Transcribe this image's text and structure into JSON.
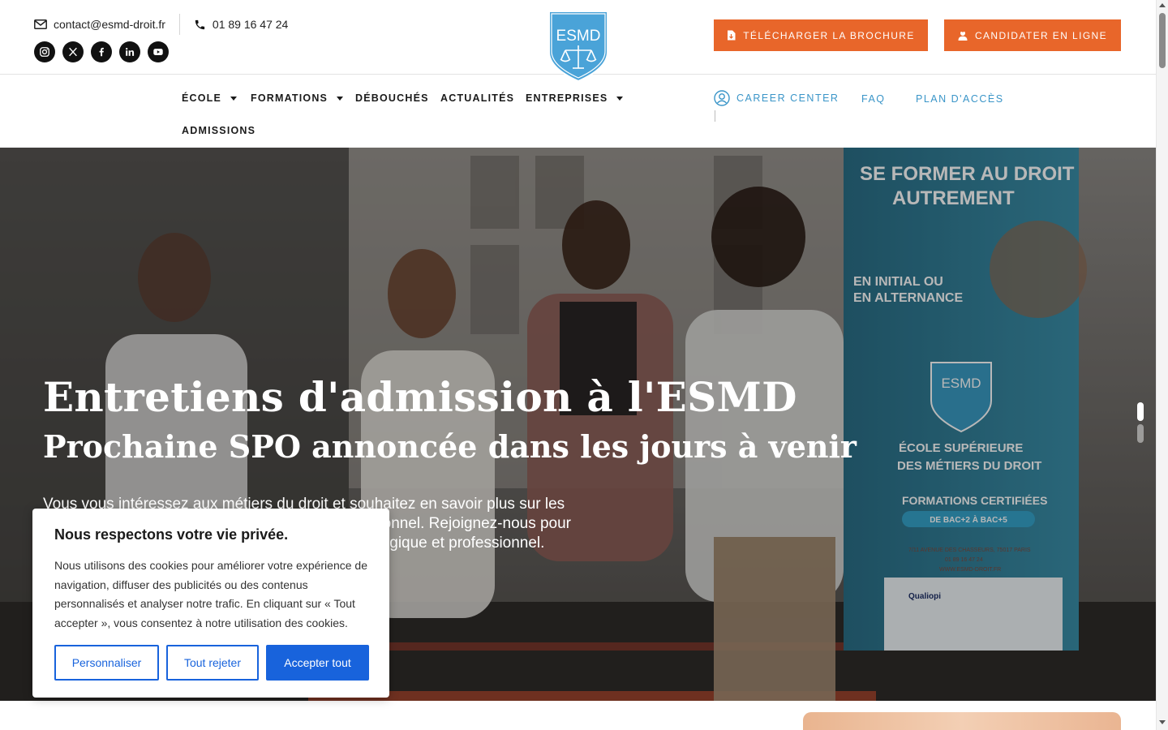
{
  "colors": {
    "accent_orange": "#e8662a",
    "nav_blue": "#3a95c8",
    "cookie_blue": "#1863dc",
    "logo_blue": "#4aa3d8"
  },
  "header": {
    "email": "contact@esmd-droit.fr",
    "phone": "01 89 16 47 24",
    "socials": [
      "instagram-icon",
      "x-icon",
      "facebook-icon",
      "linkedin-icon",
      "youtube-icon"
    ],
    "logo_text": "ESMD",
    "brochure_label": "TÉLÉCHARGER LA BROCHURE",
    "candidate_label": "CANDIDATER EN LIGNE"
  },
  "nav": {
    "items": [
      {
        "label": "ÉCOLE",
        "has_dropdown": true
      },
      {
        "label": "FORMATIONS",
        "has_dropdown": true
      },
      {
        "label": "DÉBOUCHÉS",
        "has_dropdown": false
      },
      {
        "label": "ACTUALITÉS",
        "has_dropdown": false
      },
      {
        "label": "ENTREPRISES",
        "has_dropdown": true
      },
      {
        "label": "ADMISSIONS",
        "has_dropdown": false
      }
    ],
    "right": {
      "career": "CAREER CENTER",
      "faq": "FAQ",
      "plan": "PLAN D'ACCÈS"
    }
  },
  "hero": {
    "title": "Entretiens d'admission à l'ESMD",
    "subtitle": "Prochaine SPO annoncée dans les jours à venir",
    "text": "Vous vous intéressez aux métiers du droit et souhaitez en savoir plus sur les formations de l'ESMD, ou sur votre projet professionnel. Rejoignez-nous pour une journée d'échanges avec notre équipe pédagogique et professionnel.",
    "banner": {
      "headline_1": "SE FORMER AU DROIT",
      "headline_2": "AUTREMENT",
      "alt_1": "EN INITIAL OU",
      "alt_2": "EN ALTERNANCE",
      "logo": "ESMD",
      "school_1": "ÉCOLE SUPÉRIEURE",
      "school_2": "DES MÉTIERS DU DROIT",
      "cert": "FORMATIONS CERTIFIÉES",
      "levels": "DE BAC+2 À BAC+5",
      "address": "7/11 AVENUE DES CHASSEURS, 75017 PARIS",
      "phone": "01 89 16 47 24",
      "site": "WWW.ESMD-DROIT.FR",
      "qualiopi": "Qualiopi"
    },
    "slides_total": 2,
    "active_slide": 1
  },
  "cookie": {
    "title": "Nous respectons votre vie privée.",
    "body": "Nous utilisons des cookies pour améliorer votre expérience de navigation, diffuser des publicités ou des contenus personnalisés et analyser notre trafic. En cliquant sur « Tout accepter », vous consentez à notre utilisation des cookies.",
    "customize": "Personnaliser",
    "reject": "Tout rejeter",
    "accept": "Accepter tout"
  }
}
